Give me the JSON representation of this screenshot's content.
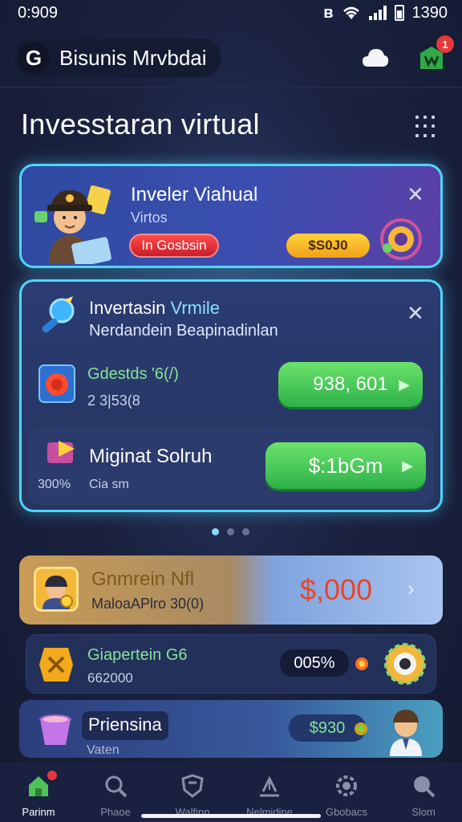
{
  "status": {
    "time": "0:909",
    "clock": "1390",
    "bluetooth": "ʙ"
  },
  "app": {
    "logo_letter": "G",
    "title": "Bisunis Mrvbdai"
  },
  "header_icons": {
    "notification_count": "1"
  },
  "page": {
    "title": "Invesstaran virtual"
  },
  "card_virtual": {
    "title": "Inveler Viahual",
    "subtitle": "Virtos",
    "tag": "In Gosbsin",
    "amount": "$S0J0"
  },
  "card_main": {
    "title_a": "Invertasin ",
    "title_b": "Vrmile",
    "subtitle": "Nerdandein Beapinadinlan",
    "item1": {
      "label": "Gdestds '6(/)",
      "value": "2 3|53(8",
      "button": "938, 601"
    },
    "item2": {
      "label": "Miginat Solruh",
      "pct": "300%",
      "sub": "Cia sm",
      "button": "$:1bGm"
    }
  },
  "carousel": {
    "count": 3,
    "active": 0
  },
  "list": [
    {
      "title": "Gnmrein Nfl",
      "sub": "MaloaAPlro 30(0)",
      "amount": "$,000"
    },
    {
      "title": "Giapertein G6",
      "sub": "662000",
      "amount": "005%"
    },
    {
      "title": "Priensina",
      "sub": "Vaten",
      "amount": "$930"
    }
  ],
  "nav": [
    {
      "label": "Parinm"
    },
    {
      "label": "Phaoe"
    },
    {
      "label": "Walfinn"
    },
    {
      "label": "Nelmidine"
    },
    {
      "label": "Gbobacs"
    },
    {
      "label": "Slom"
    }
  ],
  "colors": {
    "accent": "#4fd6ff",
    "green": "#2eb14a",
    "red": "#e53a3a",
    "gold": "#f0a11a",
    "amount_red": "#e8452c"
  }
}
